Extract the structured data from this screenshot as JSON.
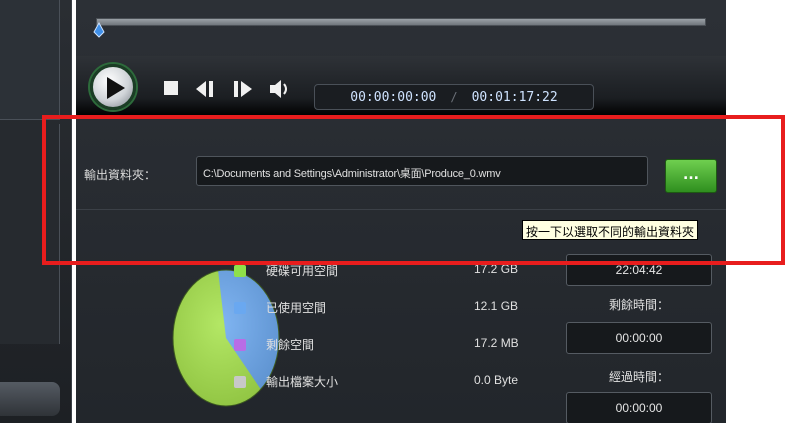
{
  "player": {
    "current_time": "00:00:00:00",
    "separator": "/",
    "total_time": "00:01:17:22"
  },
  "output": {
    "label": "輸出資料夾：",
    "path": "C:\\Documents and Settings\\Administrator\\桌面\\Produce_0.wmv",
    "browse_label": "...",
    "tooltip": "按一下以選取不同的輸出資料夾"
  },
  "disk": {
    "items": [
      {
        "label": "硬碟可用空間",
        "value": "17.2 GB",
        "color": "#8ee04a"
      },
      {
        "label": "已使用空間",
        "value": "12.1 GB",
        "color": "#6aa8f0"
      },
      {
        "label": "剩餘空間",
        "value": "17.2 MB",
        "color": "#b86de6"
      },
      {
        "label": "輸出檔案大小",
        "value": "0.0 Byte",
        "color": "#c8c8c8"
      }
    ],
    "pie_fraction_used": 0.41,
    "pie_colors": {
      "free": "#a6e34a",
      "used": "#6aa8f0"
    }
  },
  "timers": {
    "clock": "22:04:42",
    "remaining_label": "剩餘時間：",
    "remaining": "00:00:00",
    "elapsed_label": "經過時間：",
    "elapsed": "00:00:00"
  },
  "accent": {
    "highlight": "#e81d1d",
    "button_green": "#4caf30"
  }
}
